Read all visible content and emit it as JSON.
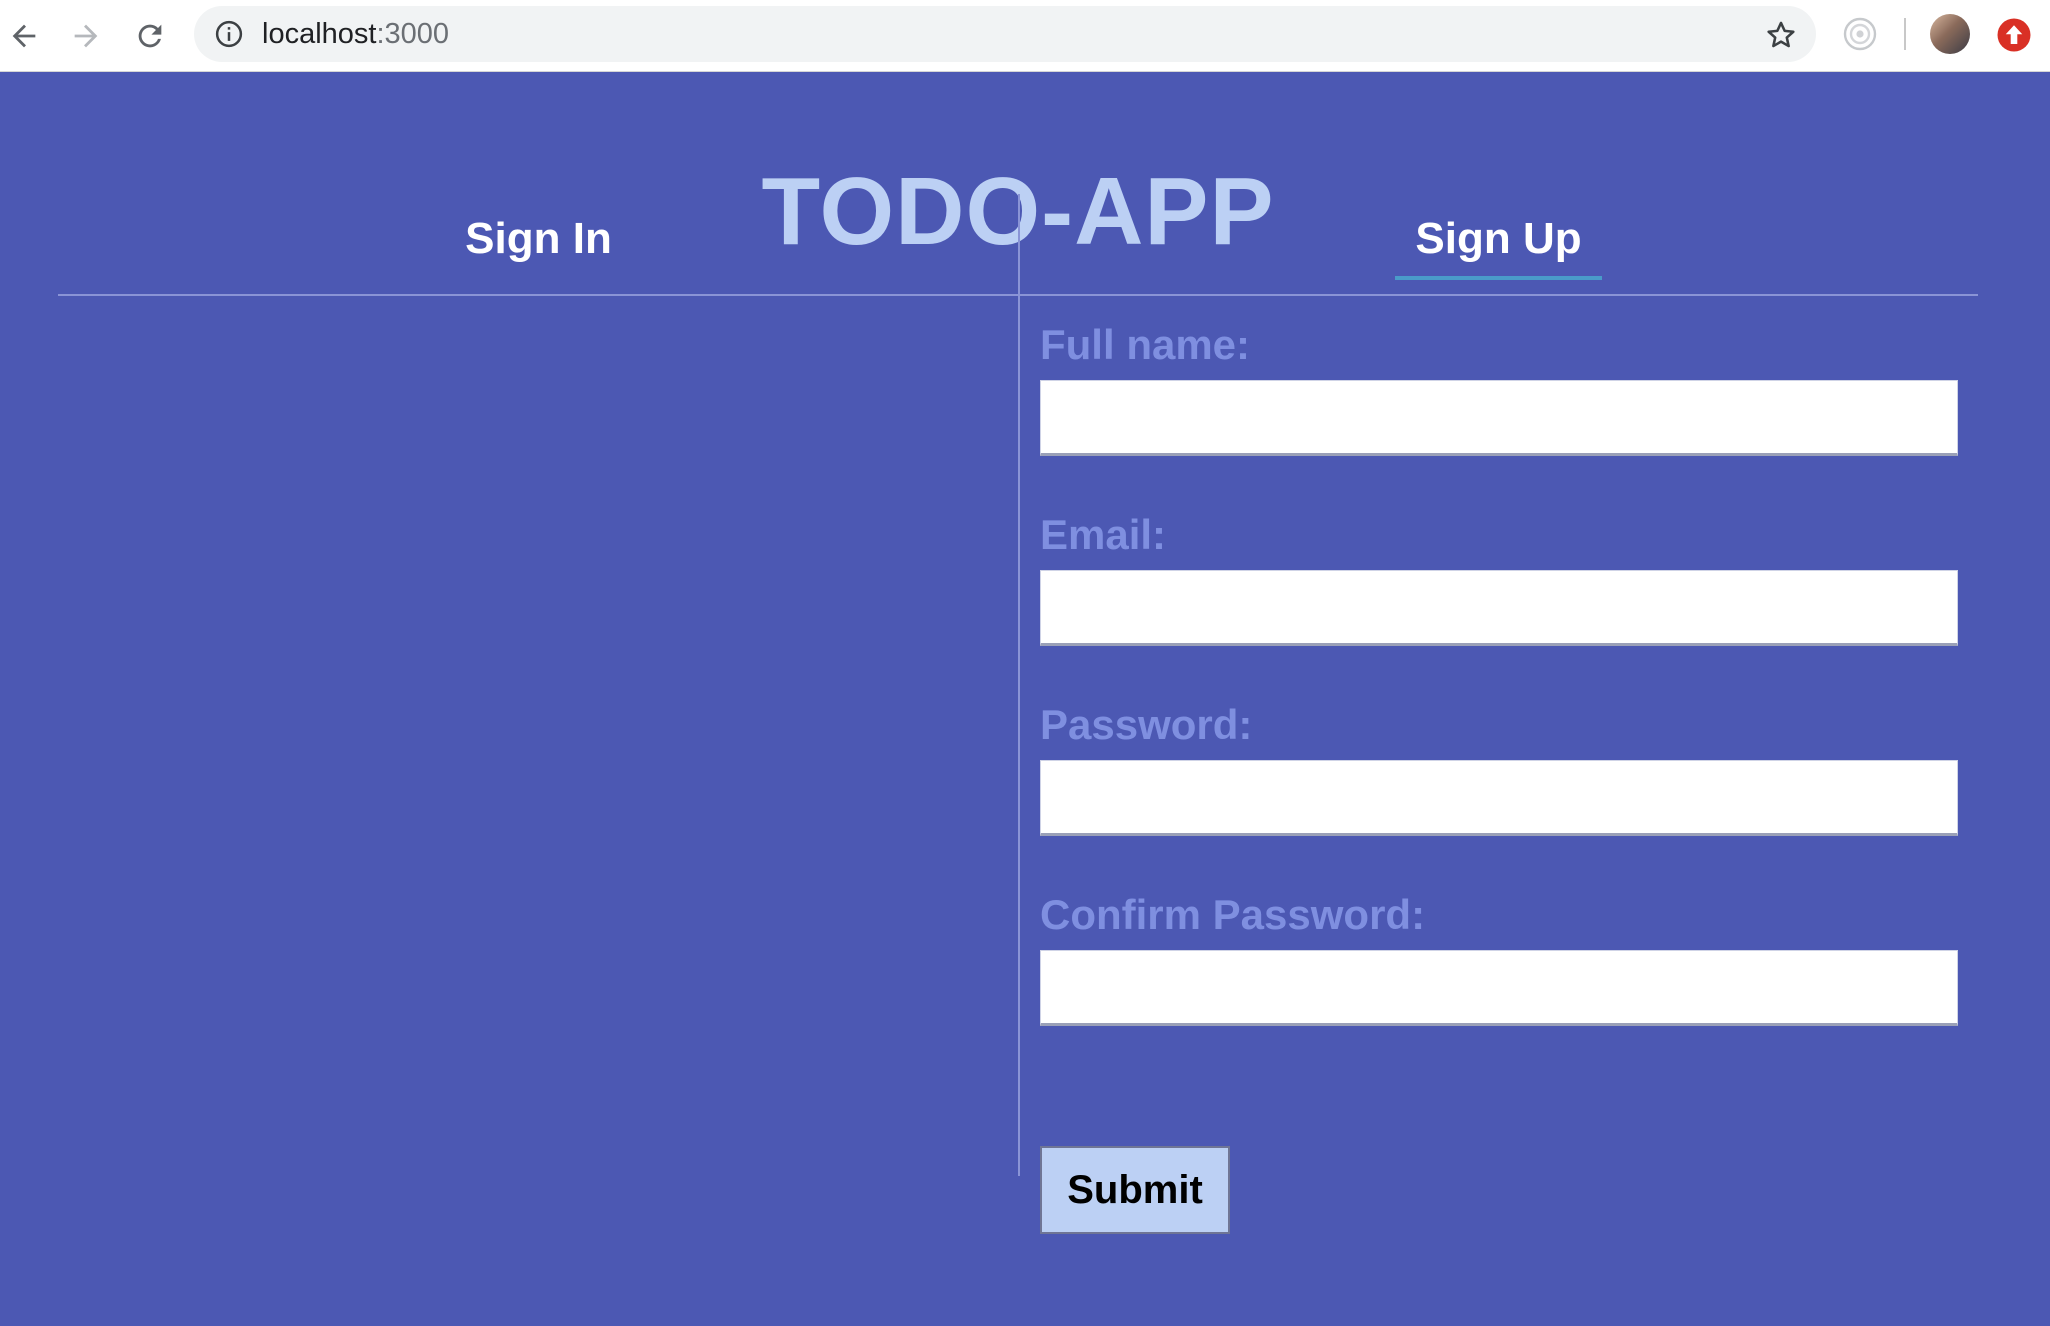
{
  "browser": {
    "url_host": "localhost",
    "url_port": ":3000",
    "icons": [
      "back-icon",
      "forward-icon",
      "reload-icon",
      "info-icon",
      "star-icon",
      "extension-icon",
      "avatar",
      "update-icon"
    ]
  },
  "app": {
    "title": "TODO-APP"
  },
  "tabs": [
    {
      "label": "Sign In",
      "active": false
    },
    {
      "label": "Sign Up",
      "active": true
    }
  ],
  "signup_form": {
    "fields": [
      {
        "label": "Full name:",
        "value": ""
      },
      {
        "label": "Email:",
        "value": ""
      },
      {
        "label": "Password:",
        "value": ""
      },
      {
        "label": "Confirm Password:",
        "value": ""
      }
    ],
    "submit_label": "Submit"
  },
  "colors": {
    "background": "#4c58b3",
    "title": "#bcd0f4",
    "field_label": "#7f8fe0",
    "tab_underline": "#4a9bc9",
    "submit_bg": "#bcd0f4"
  }
}
